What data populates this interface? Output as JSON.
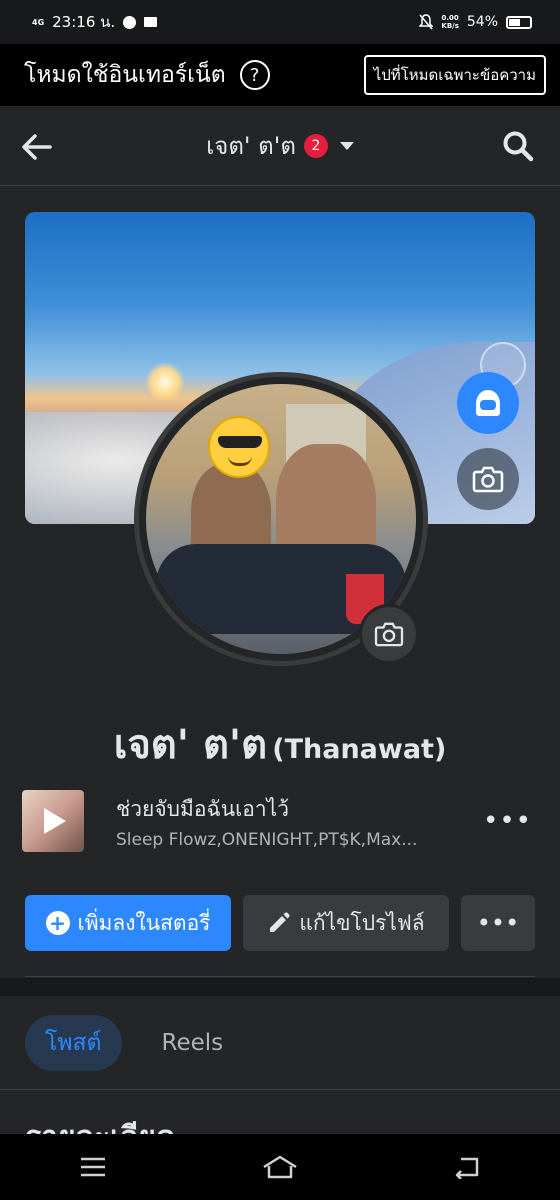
{
  "status_bar": {
    "network": "4G",
    "time": "23:16 น.",
    "speed_value": "0.00",
    "speed_unit": "KB/s",
    "battery": "54%",
    "battery_level": 0.54
  },
  "data_mode_bar": {
    "title": "โหมดใช้อินเทอร์เน็ต",
    "help_label": "?",
    "switch_button": "ไปที่โหมดเฉพาะข้อความ"
  },
  "header": {
    "title": "เจต' ต'ต",
    "badge_count": "2"
  },
  "profile": {
    "name": "เจต' ต'ต",
    "alt_name": "(Thanawat)"
  },
  "music": {
    "song_title": "ช่วยจับมือฉันเอาไว้",
    "artists": "Sleep Flowz,ONENIGHT,PT$K,Max...",
    "more_label": "•••"
  },
  "actions": {
    "add_story": "เพิ่มลงในสตอรี่",
    "edit_profile": "แก้ไขโปรไฟล์",
    "more_label": "•••"
  },
  "tabs": [
    {
      "label": "โพสต์",
      "active": true
    },
    {
      "label": "Reels",
      "active": false
    }
  ],
  "section_peek": "รายละเอียด",
  "colors": {
    "accent": "#2d88ff",
    "badge": "#e41e3f",
    "background": "#242526",
    "surface": "#3a3b3c"
  },
  "icons": {
    "back": "arrow-left-icon",
    "search": "search-icon",
    "camera": "camera-icon",
    "avatar": "avatar-icon",
    "nav": [
      "menu-icon",
      "home-icon",
      "back-icon"
    ]
  }
}
